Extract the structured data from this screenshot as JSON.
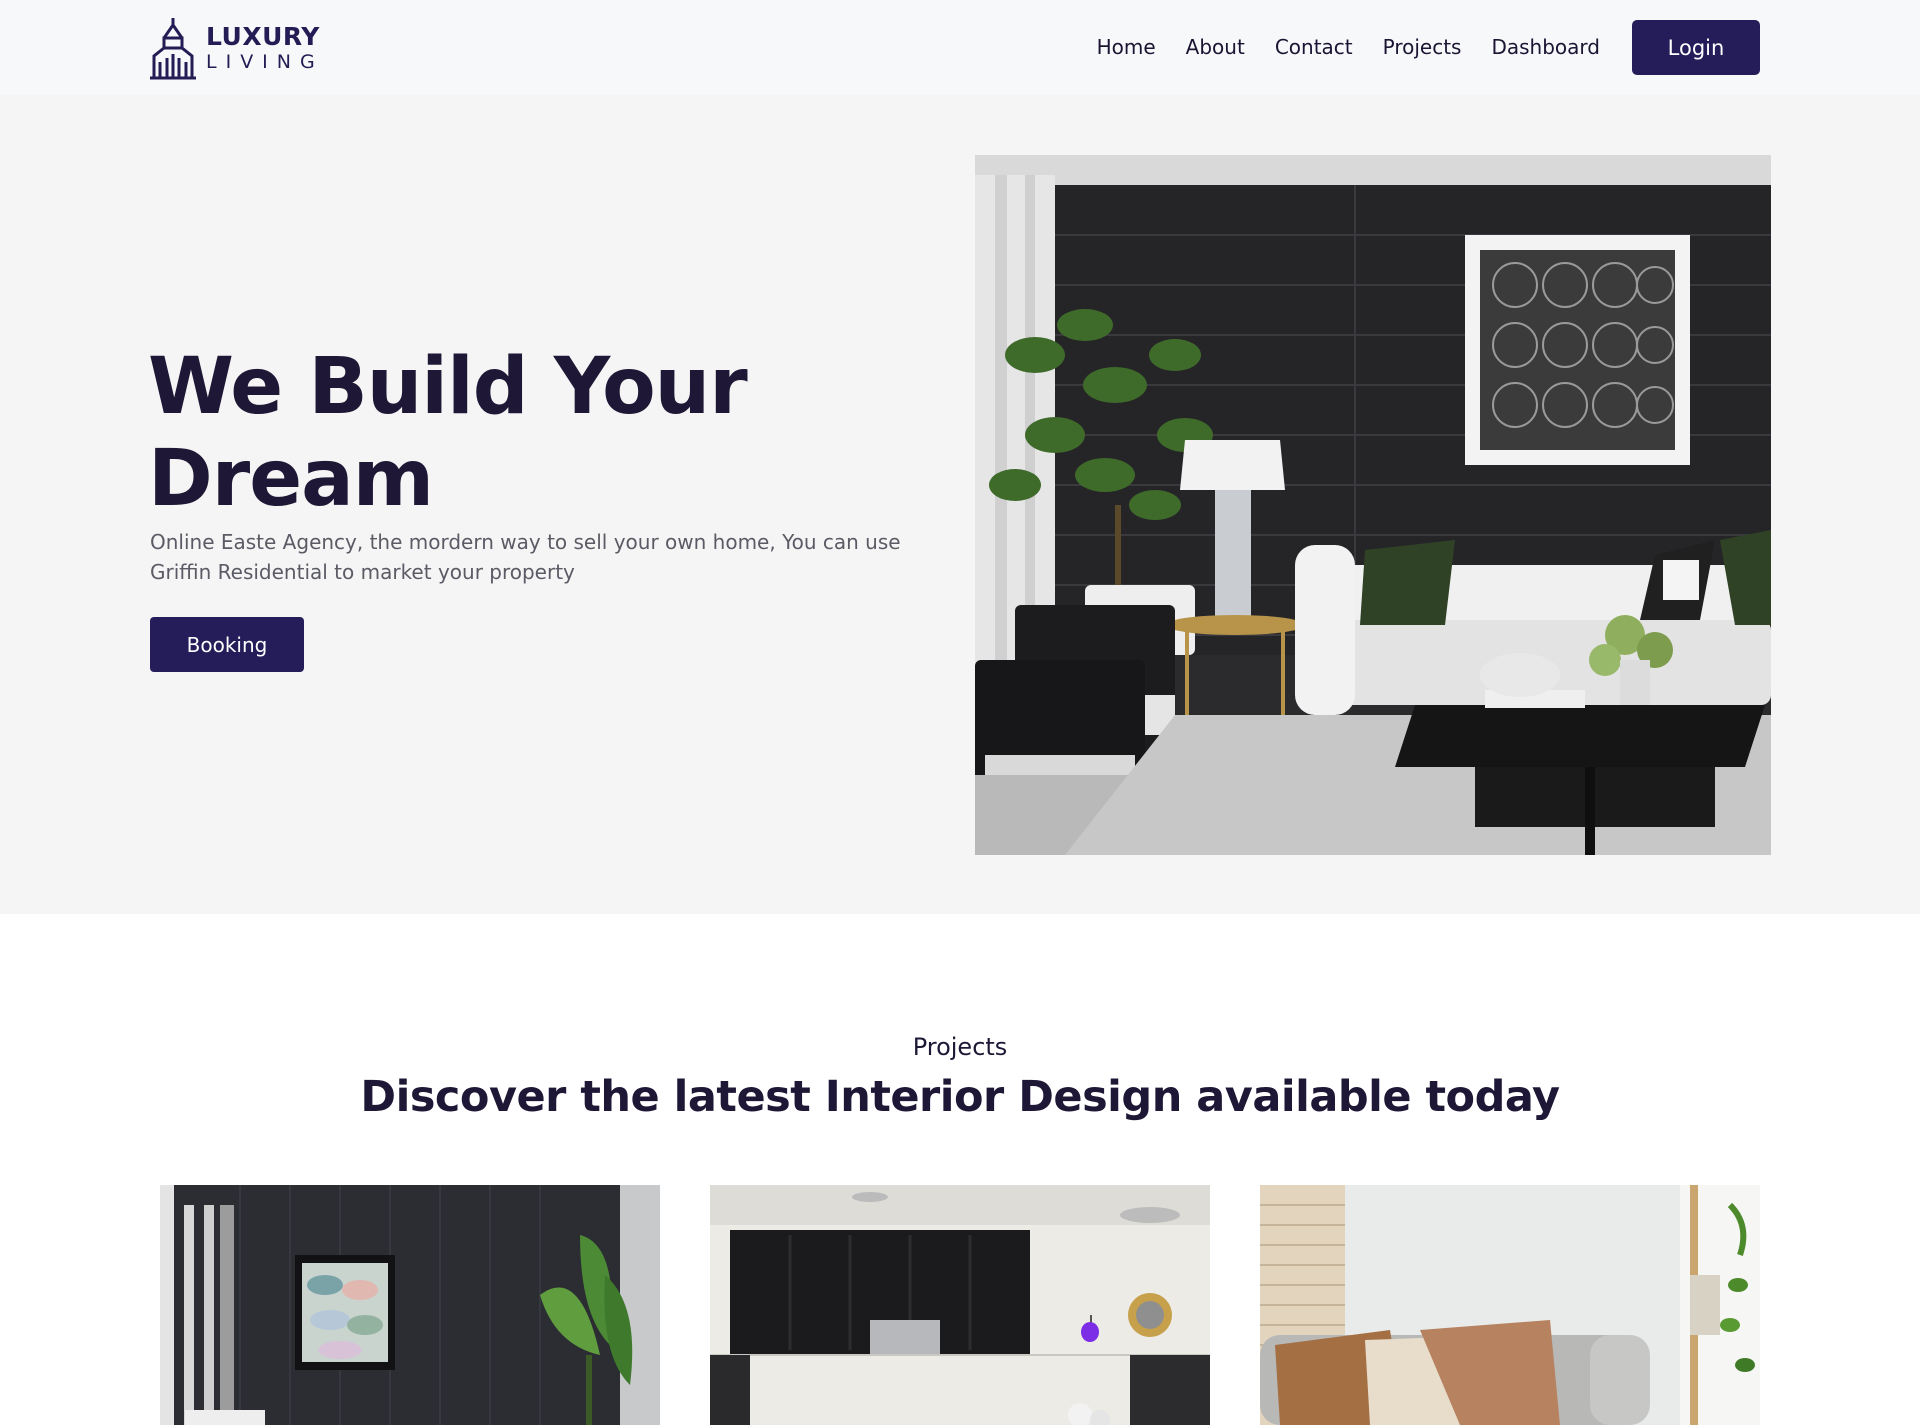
{
  "brand": {
    "line1": "LUXURY",
    "line2": "LIVING",
    "color": "#231c55"
  },
  "nav": {
    "links": [
      "Home",
      "About",
      "Contact",
      "Projects",
      "Dashboard"
    ],
    "login_label": "Login"
  },
  "hero": {
    "title": "We Build Your Dream",
    "subtitle": "Online Easte Agency, the mordern way to sell your own home, You can use Griffin Residential to market your property",
    "booking_label": "Booking",
    "image": "living-room-photo"
  },
  "projects": {
    "eyebrow": "Projects",
    "title": "Discover the latest Interior Design available today",
    "cards": [
      {
        "image": "dark-wall-plant-photo"
      },
      {
        "image": "kitchen-photo"
      },
      {
        "image": "sofa-cushions-photo"
      }
    ]
  },
  "colors": {
    "primary": "#251c5a",
    "heading": "#1e1735",
    "hero_bg": "#f5f5f5",
    "nav_bg": "#f7f8fa"
  }
}
